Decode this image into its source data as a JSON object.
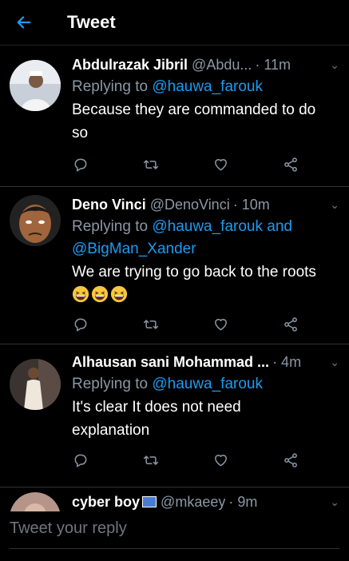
{
  "header": {
    "title": "Tweet"
  },
  "tweets": [
    {
      "name": "Abdulrazak Jibril",
      "handle": "@Abdu...",
      "time": "· 11m",
      "reply_prefix": "Replying to ",
      "reply_mentions": "@hauwa_farouk",
      "lines": [
        "Because they are commanded to do",
        "so"
      ]
    },
    {
      "name": "Deno Vinci",
      "handle": "@DenoVinci",
      "time": "· 10m",
      "reply_prefix": "Replying to ",
      "reply_mentions": "@hauwa_farouk and",
      "reply_mentions_2": "@BigMan_Xander",
      "lines": [
        "We are trying to go back to the roots"
      ],
      "emojis": [
        "grinning-squinting-face",
        "grinning-squinting-face",
        "grinning-squinting-face"
      ]
    },
    {
      "name": "Alhausan sani Mohammad ...",
      "handle": "",
      "time": "· 4m",
      "reply_prefix": "Replying to ",
      "reply_mentions": "@hauwa_farouk",
      "lines": [
        "It's clear It does not need",
        "explanation"
      ]
    },
    {
      "name": "cyber boy",
      "handle": "@mkaeey",
      "time": "· 9m"
    }
  ],
  "compose": {
    "placeholder": "Tweet your reply"
  },
  "colors": {
    "accent": "#1d9bf0",
    "muted": "#8b98a5",
    "background": "#000000"
  }
}
